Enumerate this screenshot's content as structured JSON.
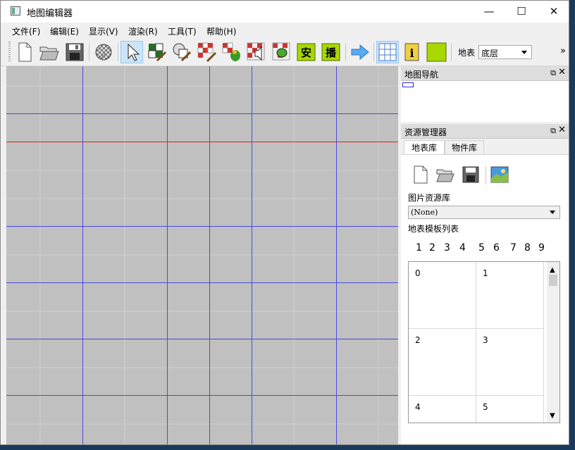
{
  "window": {
    "title": "地图编辑器",
    "minimize": "—",
    "maximize": "☐",
    "close": "✕"
  },
  "menu": [
    "文件(F)",
    "编辑(E)",
    "显示(V)",
    "渲染(R)",
    "工具(T)",
    "帮助(H)"
  ],
  "toolbar": {
    "buttons": [
      {
        "icon": "new-file-icon"
      },
      {
        "icon": "open-folder-icon"
      },
      {
        "icon": "save-icon"
      },
      {
        "icon": "checker-sphere-icon"
      },
      {
        "icon": "arrow-cursor-icon",
        "active": true
      },
      {
        "icon": "tile-paint-icon"
      },
      {
        "icon": "object-paint-icon"
      },
      {
        "icon": "checker-brush-icon"
      },
      {
        "icon": "checker-parrot-icon"
      },
      {
        "icon": "checker-speaker-icon"
      },
      {
        "icon": "checker-bug-icon"
      },
      {
        "icon": "safe-zone-icon",
        "text": "安"
      },
      {
        "icon": "broadcast-zone-icon",
        "text": "播"
      },
      {
        "icon": "arrow-right-icon"
      },
      {
        "icon": "grid-toggle-icon",
        "active": true
      },
      {
        "icon": "info-icon",
        "text": "i"
      },
      {
        "icon": "green-square-icon"
      }
    ],
    "layer_label": "地表",
    "layer_value": "底层",
    "overflow": "»"
  },
  "colors": {
    "canvas": "#c0c0c0",
    "grid_blue": "#4a4ae0",
    "axis_red": "#e02020",
    "lime": "#a8d800"
  },
  "navigator": {
    "title": "地图导航",
    "float": "⧉",
    "close": "✕"
  },
  "resources": {
    "title": "资源管理器",
    "float": "⧉",
    "close": "✕",
    "tabs": [
      "地表库",
      "物件库"
    ],
    "image_lib_label": "图片资源库",
    "image_lib_value": "(None)",
    "template_label": "地表模板列表",
    "numbers": [
      "1",
      "2",
      "3",
      "4",
      "5",
      "6",
      "7",
      "8",
      "9"
    ],
    "cells": [
      "0",
      "1",
      "2",
      "3",
      "4",
      "5"
    ],
    "scroll_up": "▲",
    "scroll_down": "▼"
  }
}
